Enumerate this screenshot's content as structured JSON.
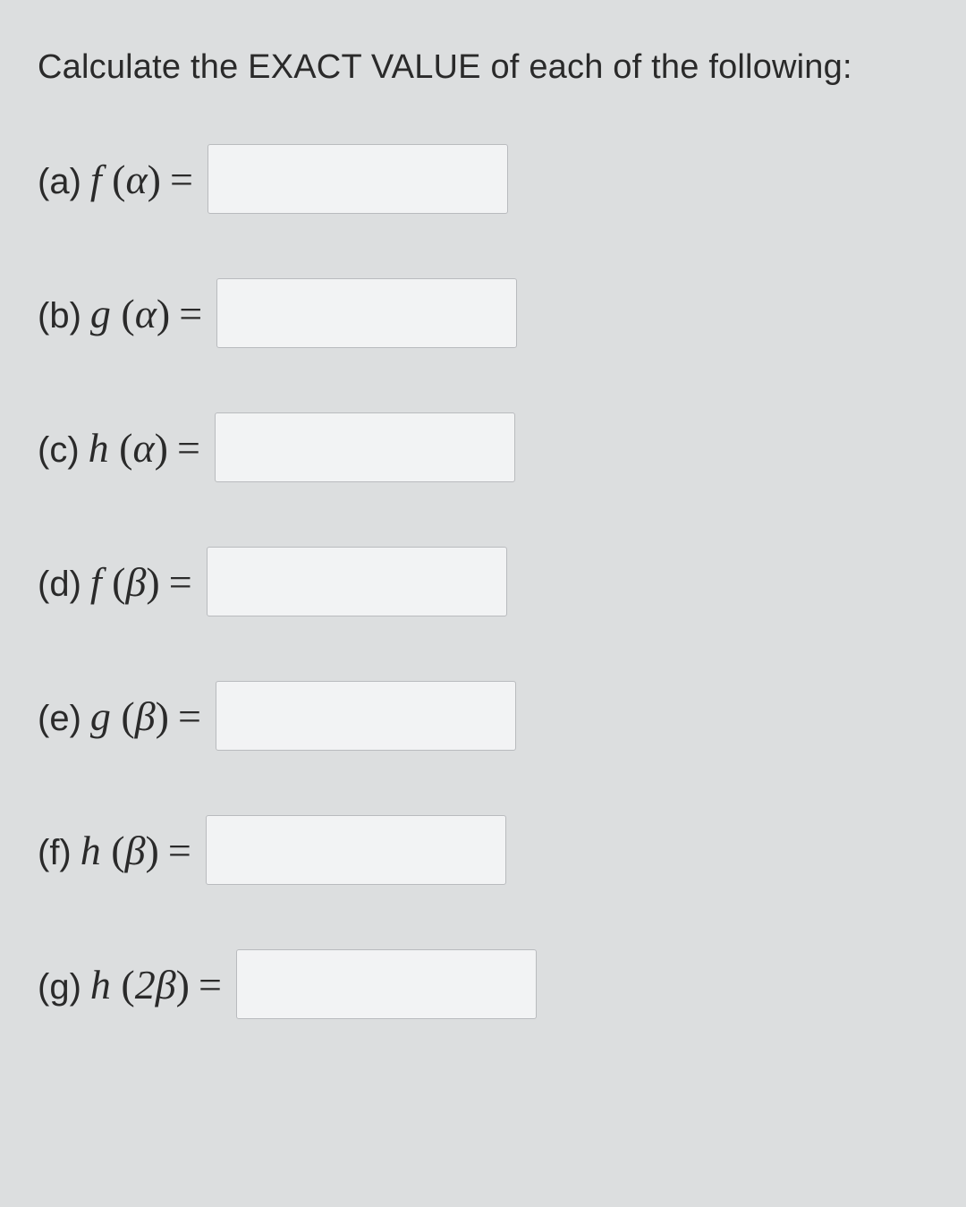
{
  "prompt": "Calculate the EXACT VALUE of each of the following:",
  "questions": [
    {
      "letter": "(a)",
      "fn": "f",
      "arg": "α",
      "value": ""
    },
    {
      "letter": "(b)",
      "fn": "g",
      "arg": "α",
      "value": ""
    },
    {
      "letter": "(c)",
      "fn": "h",
      "arg": "α",
      "value": ""
    },
    {
      "letter": "(d)",
      "fn": "f",
      "arg": "β",
      "value": ""
    },
    {
      "letter": "(e)",
      "fn": "g",
      "arg": "β",
      "value": ""
    },
    {
      "letter": "(f)",
      "fn": "h",
      "arg": "β",
      "value": ""
    },
    {
      "letter": "(g)",
      "fn": "h",
      "arg": "2β",
      "value": ""
    }
  ]
}
